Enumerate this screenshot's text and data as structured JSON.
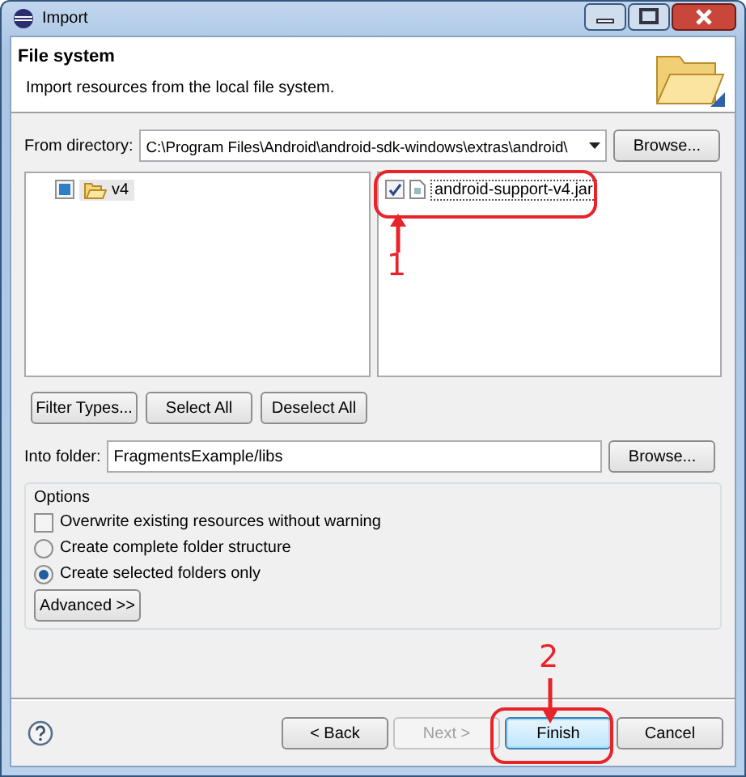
{
  "window": {
    "title": "Import"
  },
  "header": {
    "title": "File system",
    "description": "Import resources from the local file system."
  },
  "from_directory": {
    "label": "From directory:",
    "value": "C:\\Program Files\\Android\\android-sdk-windows\\extras\\android\\",
    "browse": "Browse..."
  },
  "folders": [
    {
      "label": "v4",
      "checked": true,
      "grayed": true,
      "selected": true
    }
  ],
  "files": [
    {
      "label": "android-support-v4.jar",
      "checked": true,
      "selected": true
    }
  ],
  "list_buttons": [
    "Filter Types...",
    "Select All",
    "Deselect All"
  ],
  "into_folder": {
    "label": "Into folder:",
    "value": "FragmentsExample/libs",
    "browse": "Browse..."
  },
  "options": {
    "title": "Options",
    "items": [
      {
        "kind": "checkbox",
        "label": "Overwrite existing resources without warning",
        "checked": false
      },
      {
        "kind": "radio",
        "label": "Create complete folder structure",
        "selected": false
      },
      {
        "kind": "radio",
        "label": "Create selected folders only",
        "selected": true
      }
    ],
    "advanced": "Advanced >>"
  },
  "footer_buttons": [
    {
      "label": "< Back",
      "disabled": false,
      "focused": false
    },
    {
      "label": "Next >",
      "disabled": true,
      "focused": false
    },
    {
      "label": "Finish",
      "disabled": false,
      "focused": true
    },
    {
      "label": "Cancel",
      "disabled": false,
      "focused": false
    }
  ],
  "annotations": [
    {
      "label": "1"
    },
    {
      "label": "2"
    }
  ]
}
